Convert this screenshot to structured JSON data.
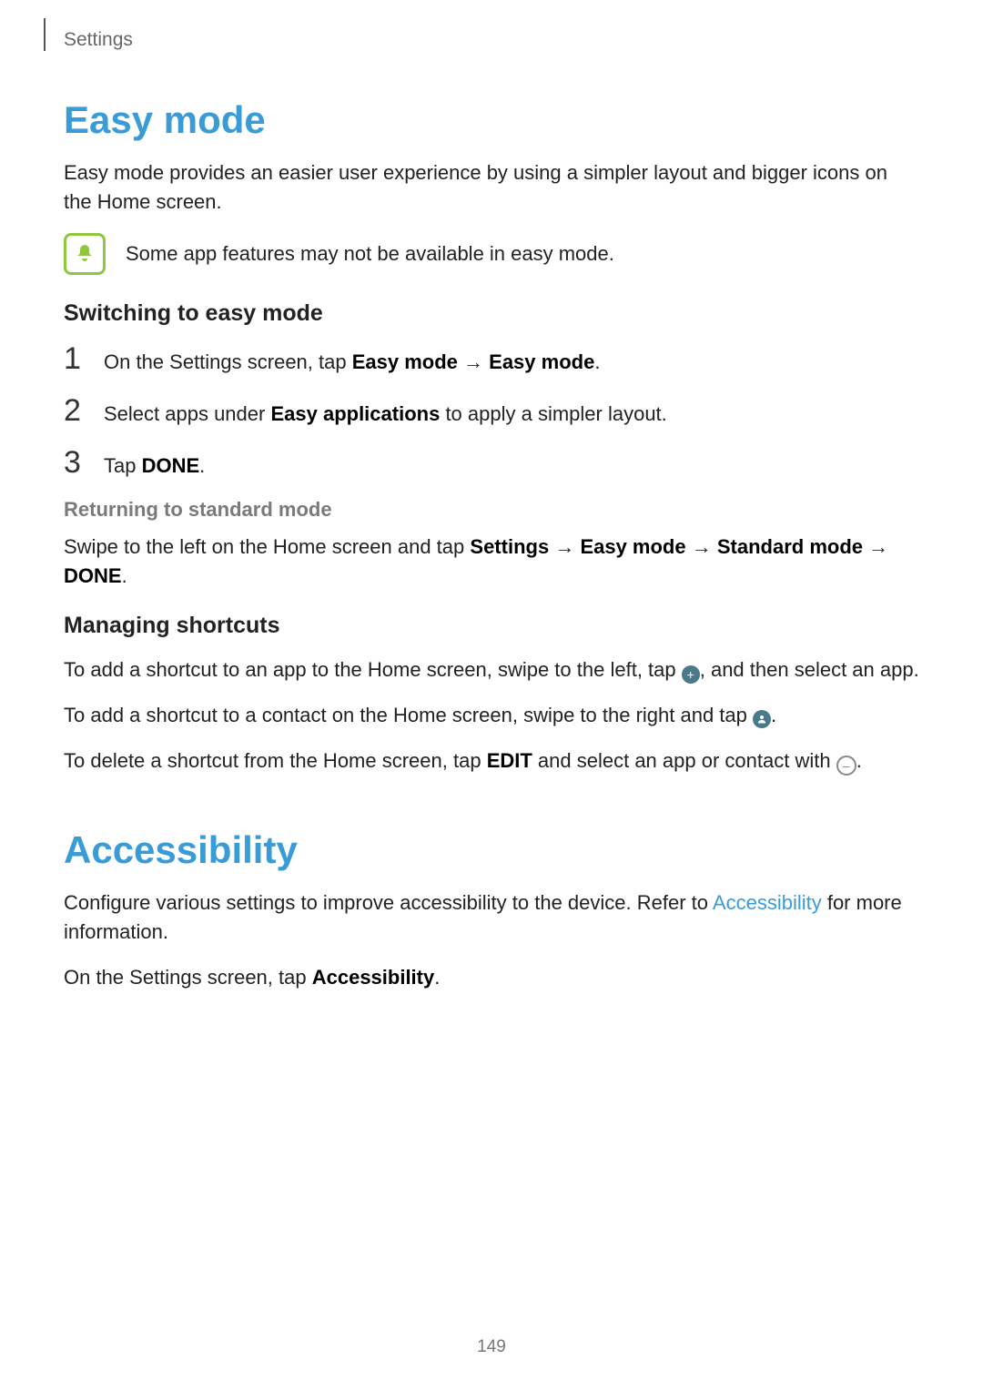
{
  "breadcrumb": "Settings",
  "page_number": "149",
  "arrow": "→",
  "easy_mode": {
    "heading": "Easy mode",
    "intro": "Easy mode provides an easier user experience by using a simpler layout and bigger icons on the Home screen.",
    "note": "Some app features may not be available in easy mode.",
    "switch_heading": "Switching to easy mode",
    "step1_pre": "On the Settings screen, tap ",
    "step1_b1": "Easy mode",
    "step1_mid": " → ",
    "step1_b2": "Easy mode",
    "step1_post": ".",
    "step2_pre": "Select apps under ",
    "step2_b1": "Easy applications",
    "step2_post": " to apply a simpler layout.",
    "step3_pre": "Tap ",
    "step3_b1": "DONE",
    "step3_post": ".",
    "return_heading": "Returning to standard mode",
    "return_pre": "Swipe to the left on the Home screen and tap ",
    "return_b1": "Settings",
    "return_b2": "Easy mode",
    "return_b3": "Standard mode",
    "return_b4": "DONE",
    "return_post": ".",
    "shortcuts_heading": "Managing shortcuts",
    "sc1_pre": "To add a shortcut to an app to the Home screen, swipe to the left, tap ",
    "sc1_post": ", and then select an app.",
    "sc2_pre": "To add a shortcut to a contact on the Home screen, swipe to the right and tap ",
    "sc2_post": ".",
    "sc3_pre": "To delete a shortcut from the Home screen, tap ",
    "sc3_b1": "EDIT",
    "sc3_mid": " and select an app or contact with ",
    "sc3_post": "."
  },
  "accessibility": {
    "heading": "Accessibility",
    "p1_pre": "Configure various settings to improve accessibility to the device. Refer to ",
    "p1_link": "Accessibility",
    "p1_post": " for more information.",
    "p2_pre": "On the Settings screen, tap ",
    "p2_b1": "Accessibility",
    "p2_post": "."
  }
}
